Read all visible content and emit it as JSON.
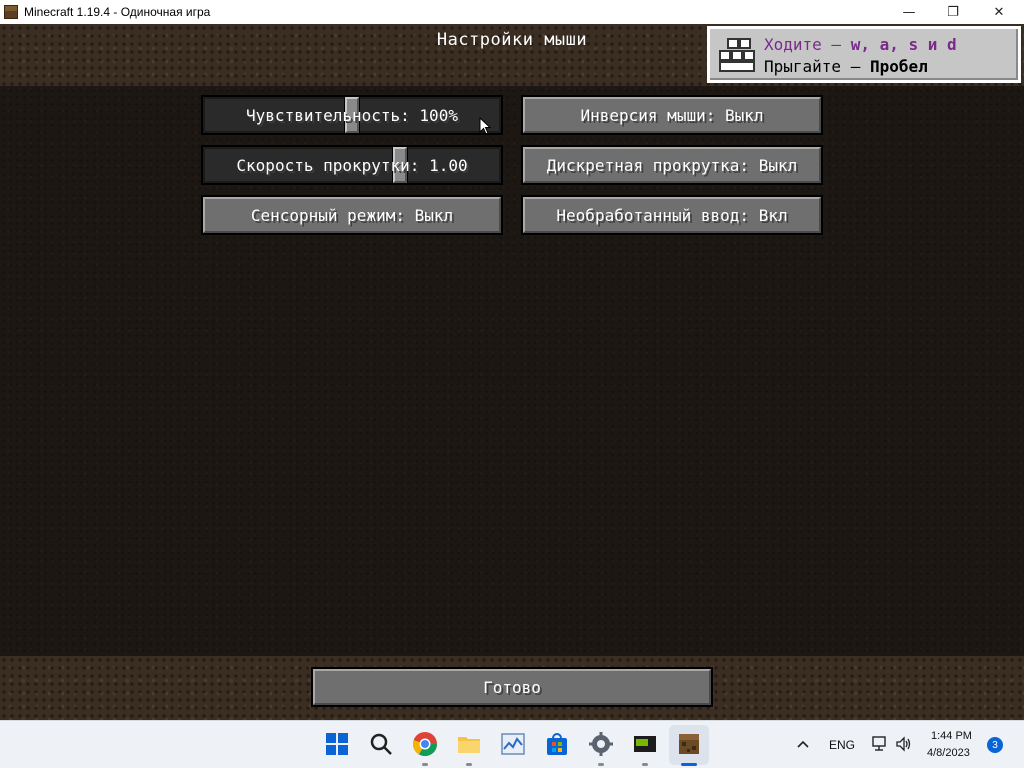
{
  "window": {
    "title": "Minecraft 1.19.4 - Одиночная игра",
    "minimize_glyph": "—",
    "restore_glyph": "❐",
    "close_glyph": "✕"
  },
  "screen": {
    "title": "Настройки мыши"
  },
  "tutorial": {
    "move_prefix": "Ходите — ",
    "move_keys": "w, a, s и d",
    "jump_prefix": "Прыгайте — ",
    "jump_key": "Пробел"
  },
  "options": {
    "sensitivity": {
      "label": "Чувствительность: 100%",
      "value_fraction": 0.5
    },
    "invert_mouse": {
      "label": "Инверсия мыши: Выкл"
    },
    "scroll_speed": {
      "label": "Скорость прокрутки: 1.00",
      "value_fraction": 0.67
    },
    "discrete_scroll": {
      "label": "Дискретная прокрутка: Выкл"
    },
    "touchscreen": {
      "label": "Сенсорный режим: Выкл"
    },
    "raw_input": {
      "label": "Необработанный ввод: Вкл"
    }
  },
  "done_button": {
    "label": "Готово"
  },
  "taskbar": {
    "language": "ENG",
    "time": "1:44 PM",
    "date": "4/8/2023",
    "notifications": "3"
  },
  "colors": {
    "tutorial_accent": "#7a2a8a",
    "windows_blue": "#0a64d6"
  }
}
